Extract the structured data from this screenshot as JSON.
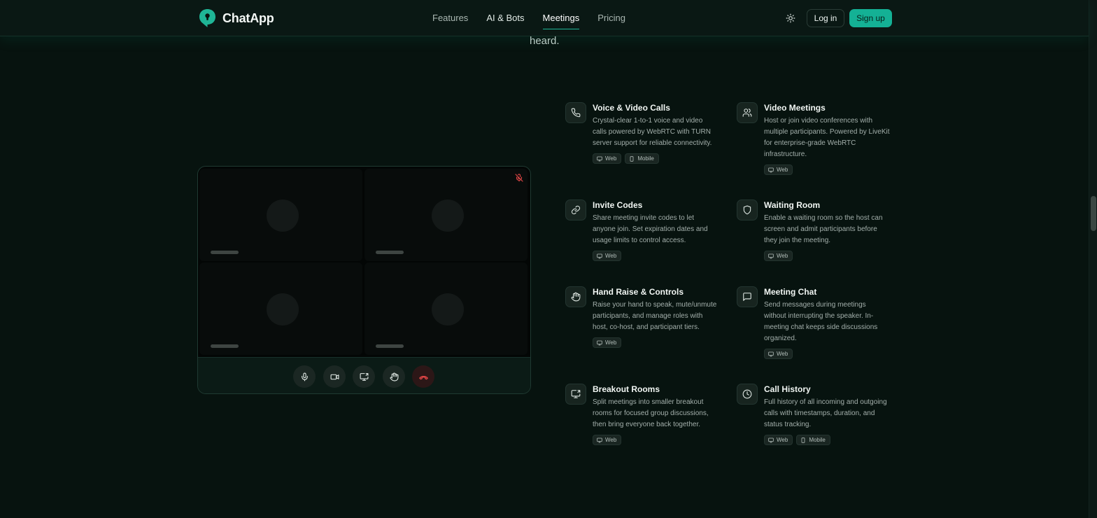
{
  "header": {
    "brand": "ChatApp",
    "nav": [
      {
        "label": "Features"
      },
      {
        "label": "AI & Bots"
      },
      {
        "label": "Meetings"
      },
      {
        "label": "Pricing"
      }
    ],
    "login_label": "Log in",
    "signup_label": "Sign up"
  },
  "hero": {
    "partial_text": "heard."
  },
  "features": [
    {
      "title": "Voice & Video Calls",
      "desc": "Crystal-clear 1-to-1 voice and video calls powered by WebRTC with TURN server support for reliable connectivity.",
      "icon": "phone-icon",
      "tags": [
        "Web",
        "Mobile"
      ]
    },
    {
      "title": "Video Meetings",
      "desc": "Host or join video conferences with multiple participants. Powered by LiveKit for enterprise-grade WebRTC infrastructure.",
      "icon": "users-icon",
      "tags": [
        "Web"
      ]
    },
    {
      "title": "Invite Codes",
      "desc": "Share meeting invite codes to let anyone join. Set expiration dates and usage limits to control access.",
      "icon": "link-icon",
      "tags": [
        "Web"
      ]
    },
    {
      "title": "Waiting Room",
      "desc": "Enable a waiting room so the host can screen and admit participants before they join the meeting.",
      "icon": "shield-icon",
      "tags": [
        "Web"
      ]
    },
    {
      "title": "Hand Raise & Controls",
      "desc": "Raise your hand to speak, mute/unmute participants, and manage roles with host, co-host, and participant tiers.",
      "icon": "hand-icon",
      "tags": [
        "Web"
      ]
    },
    {
      "title": "Meeting Chat",
      "desc": "Send messages during meetings without interrupting the speaker. In-meeting chat keeps side discussions organized.",
      "icon": "message-icon",
      "tags": [
        "Web"
      ]
    },
    {
      "title": "Breakout Rooms",
      "desc": "Split meetings into smaller breakout rooms for focused group discussions, then bring everyone back together.",
      "icon": "screen-share-icon",
      "tags": [
        "Web"
      ]
    },
    {
      "title": "Call History",
      "desc": "Full history of all incoming and outgoing calls with timestamps, duration, and status tracking.",
      "icon": "clock-icon",
      "tags": [
        "Web",
        "Mobile"
      ]
    }
  ]
}
